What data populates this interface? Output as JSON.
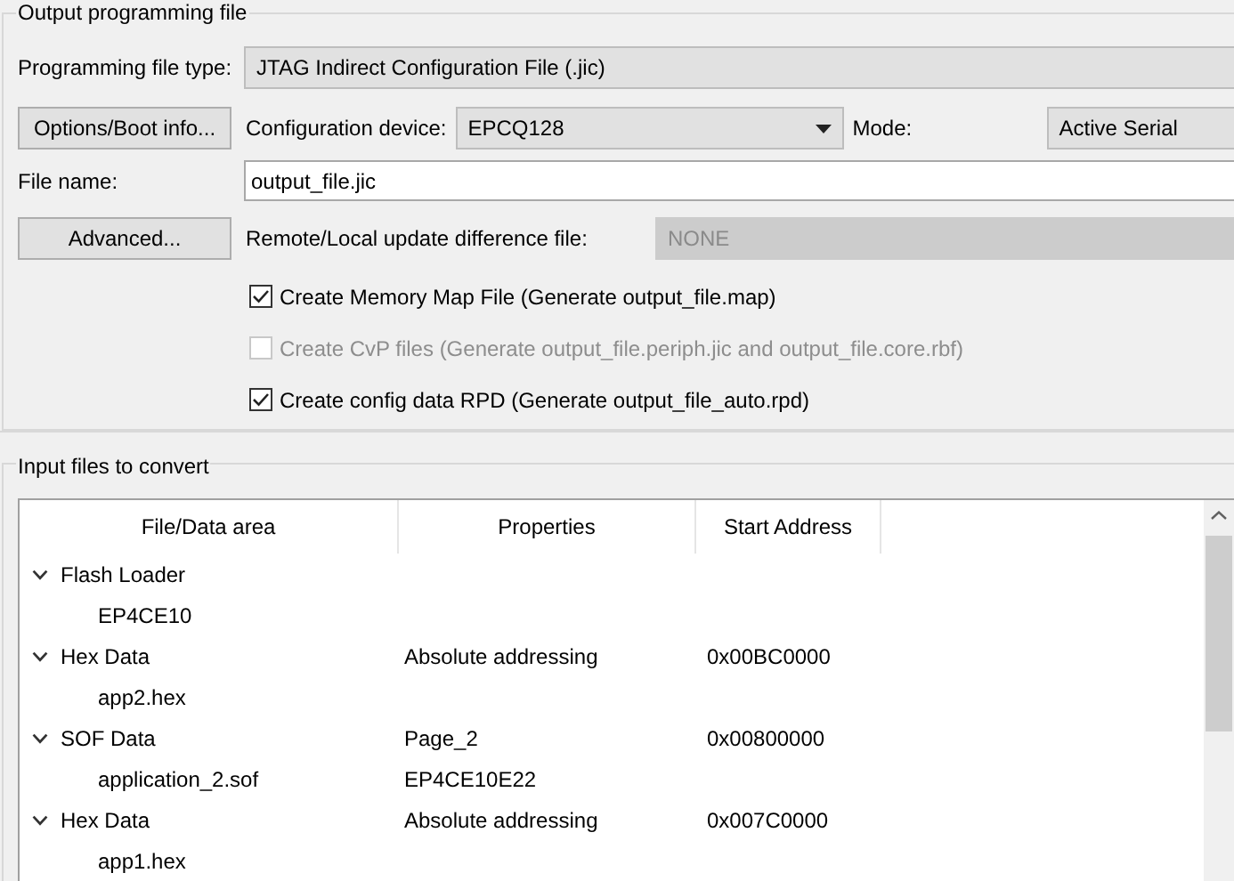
{
  "output_group": {
    "title": "Output programming file",
    "file_type": {
      "label": "Programming file type:",
      "value": "JTAG Indirect Configuration File (.jic)"
    },
    "options_button": "Options/Boot info...",
    "config_device": {
      "label": "Configuration device:",
      "value": "EPCQ128"
    },
    "mode": {
      "label": "Mode:",
      "value": "Active Serial"
    },
    "file_name": {
      "label": "File name:",
      "value": "output_file.jic"
    },
    "advanced_button": "Advanced...",
    "difference_file": {
      "label": "Remote/Local update difference file:",
      "value": "NONE",
      "disabled": true
    },
    "checkboxes": [
      {
        "label": "Create Memory Map File (Generate output_file.map)",
        "checked": true,
        "disabled": false
      },
      {
        "label": "Create CvP files (Generate output_file.periph.jic and output_file.core.rbf)",
        "checked": false,
        "disabled": true
      },
      {
        "label": "Create config data RPD (Generate output_file_auto.rpd)",
        "checked": true,
        "disabled": false
      }
    ]
  },
  "input_group": {
    "title": "Input files to convert",
    "columns": [
      "File/Data area",
      "Properties",
      "Start Address"
    ],
    "rows": [
      {
        "name": "Flash Loader",
        "expanded": true,
        "children": [
          {
            "name": "EP4CE10"
          }
        ]
      },
      {
        "name": "Hex Data",
        "properties": "Absolute addressing",
        "start_address": "0x00BC0000",
        "expanded": true,
        "children": [
          {
            "name": "app2.hex"
          }
        ]
      },
      {
        "name": "SOF Data",
        "properties": "Page_2",
        "start_address": "0x00800000",
        "expanded": true,
        "children": [
          {
            "name": "application_2.sof",
            "properties": "EP4CE10E22"
          }
        ]
      },
      {
        "name": "Hex Data",
        "properties": "Absolute addressing",
        "start_address": "0x007C0000",
        "expanded": true,
        "children": [
          {
            "name": "app1.hex"
          }
        ]
      }
    ]
  }
}
